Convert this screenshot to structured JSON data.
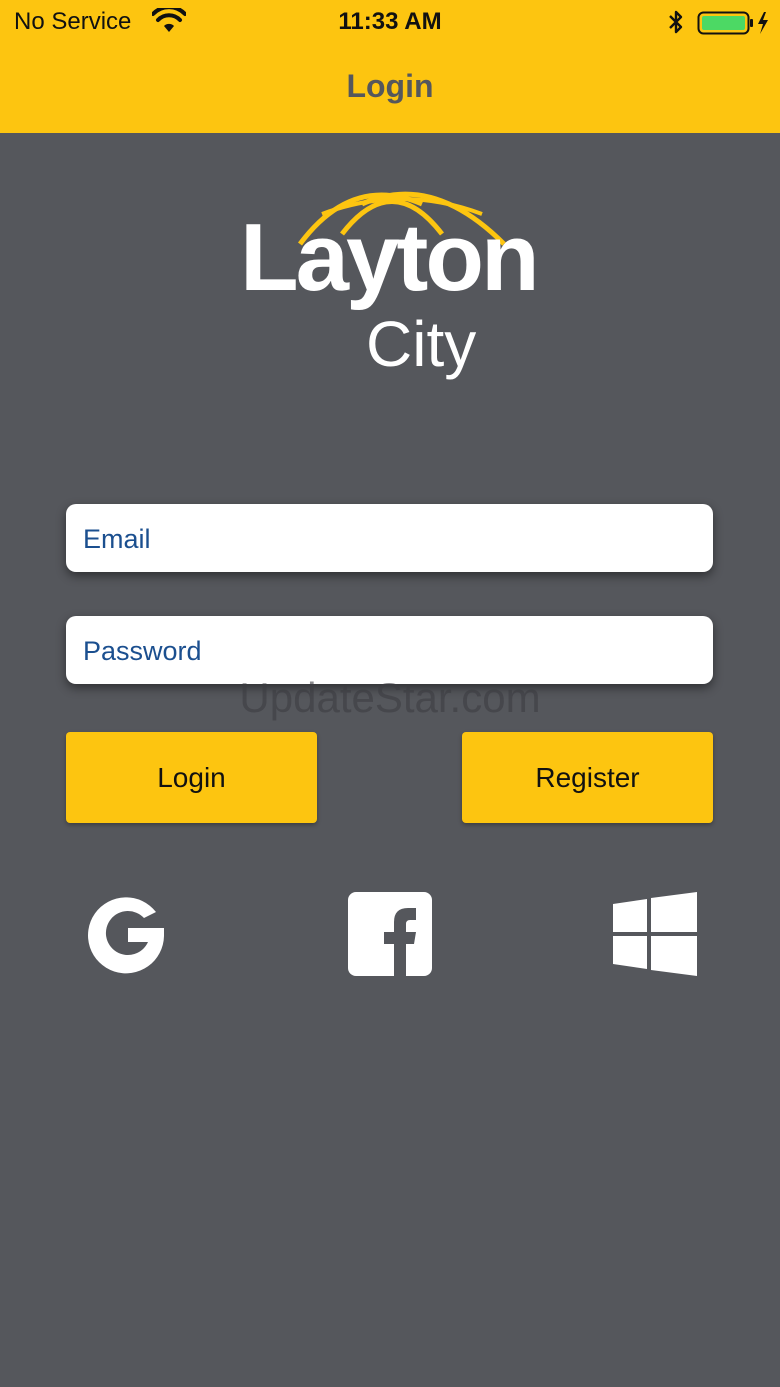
{
  "status_bar": {
    "carrier": "No Service",
    "time": "11:33 AM",
    "battery_color": "#4cd964"
  },
  "nav": {
    "title": "Login",
    "background": "#fdc510"
  },
  "logo": {
    "line1": "Layton",
    "line2": "City",
    "accent": "#fdc510"
  },
  "form": {
    "email_placeholder": "Email",
    "password_placeholder": "Password"
  },
  "buttons": {
    "login": "Login",
    "register": "Register"
  },
  "social": {
    "icons": [
      "google-icon",
      "facebook-icon",
      "windows-icon"
    ]
  },
  "watermark": "UpdateStar.com",
  "colors": {
    "background": "#55575c",
    "accent": "#fdc510",
    "placeholder": "#1b4f8f"
  }
}
